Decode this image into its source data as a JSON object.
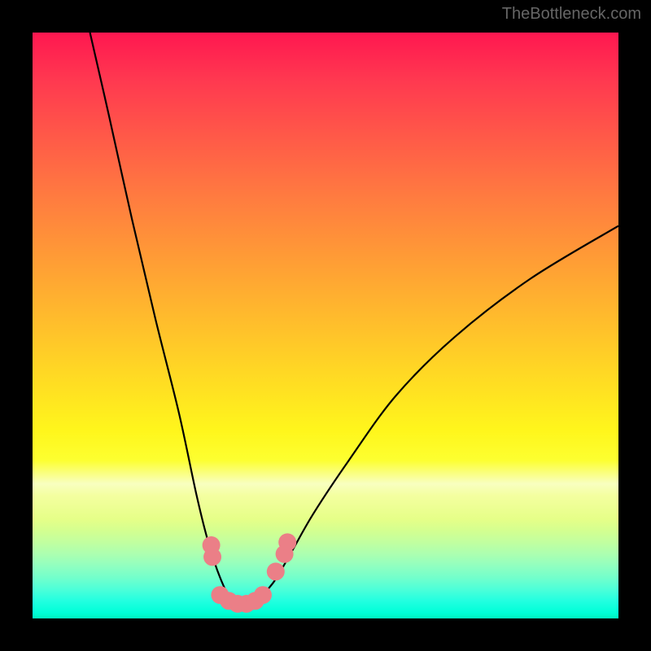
{
  "watermark": "TheBottleneck.com",
  "chart_data": {
    "type": "line",
    "title": "",
    "xlabel": "",
    "ylabel": "",
    "xlim": [
      0,
      100
    ],
    "ylim": [
      0,
      100
    ],
    "curve": {
      "description": "V-shaped bottleneck curve with minimum near x=35",
      "path_points": [
        {
          "x": 9.8,
          "y": 100
        },
        {
          "x": 13,
          "y": 86
        },
        {
          "x": 17,
          "y": 68
        },
        {
          "x": 21,
          "y": 51
        },
        {
          "x": 25,
          "y": 35
        },
        {
          "x": 28,
          "y": 21
        },
        {
          "x": 30,
          "y": 13
        },
        {
          "x": 32,
          "y": 7
        },
        {
          "x": 34,
          "y": 3
        },
        {
          "x": 36,
          "y": 2
        },
        {
          "x": 38,
          "y": 3
        },
        {
          "x": 41,
          "y": 6
        },
        {
          "x": 44,
          "y": 11
        },
        {
          "x": 48,
          "y": 18
        },
        {
          "x": 54,
          "y": 27
        },
        {
          "x": 62,
          "y": 38
        },
        {
          "x": 72,
          "y": 48
        },
        {
          "x": 85,
          "y": 58
        },
        {
          "x": 100,
          "y": 67
        }
      ]
    },
    "markers": [
      {
        "x": 30.5,
        "y": 12.5,
        "color": "#eb7f87"
      },
      {
        "x": 30.7,
        "y": 10.5,
        "color": "#eb7f87"
      },
      {
        "x": 32.0,
        "y": 4.0,
        "color": "#eb7f87"
      },
      {
        "x": 33.5,
        "y": 3.0,
        "color": "#eb7f87"
      },
      {
        "x": 35.0,
        "y": 2.5,
        "color": "#eb7f87"
      },
      {
        "x": 36.5,
        "y": 2.5,
        "color": "#eb7f87"
      },
      {
        "x": 38.0,
        "y": 3.0,
        "color": "#eb7f87"
      },
      {
        "x": 39.3,
        "y": 4.0,
        "color": "#eb7f87"
      },
      {
        "x": 41.5,
        "y": 8.0,
        "color": "#eb7f87"
      },
      {
        "x": 43.0,
        "y": 11.0,
        "color": "#eb7f87"
      },
      {
        "x": 43.5,
        "y": 13.0,
        "color": "#eb7f87"
      }
    ],
    "colors": {
      "curve_stroke": "#000000",
      "marker_fill": "#eb7f87",
      "gradient_top": "#ff1750",
      "gradient_bottom": "#00f5c0"
    }
  }
}
